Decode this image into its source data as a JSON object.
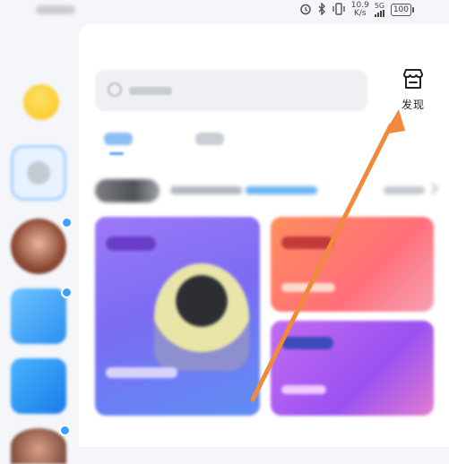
{
  "status_bar": {
    "net_speed_value": "10.9",
    "net_speed_unit": "K/s",
    "network": "5G",
    "battery": "100"
  },
  "header": {
    "discover_label": "发现",
    "discover_icon": "store-icon"
  },
  "annotation": {
    "arrow_color": "#f08a3c"
  },
  "colors": {
    "accent": "#4ea3f4",
    "background": "#f4f6fa"
  }
}
